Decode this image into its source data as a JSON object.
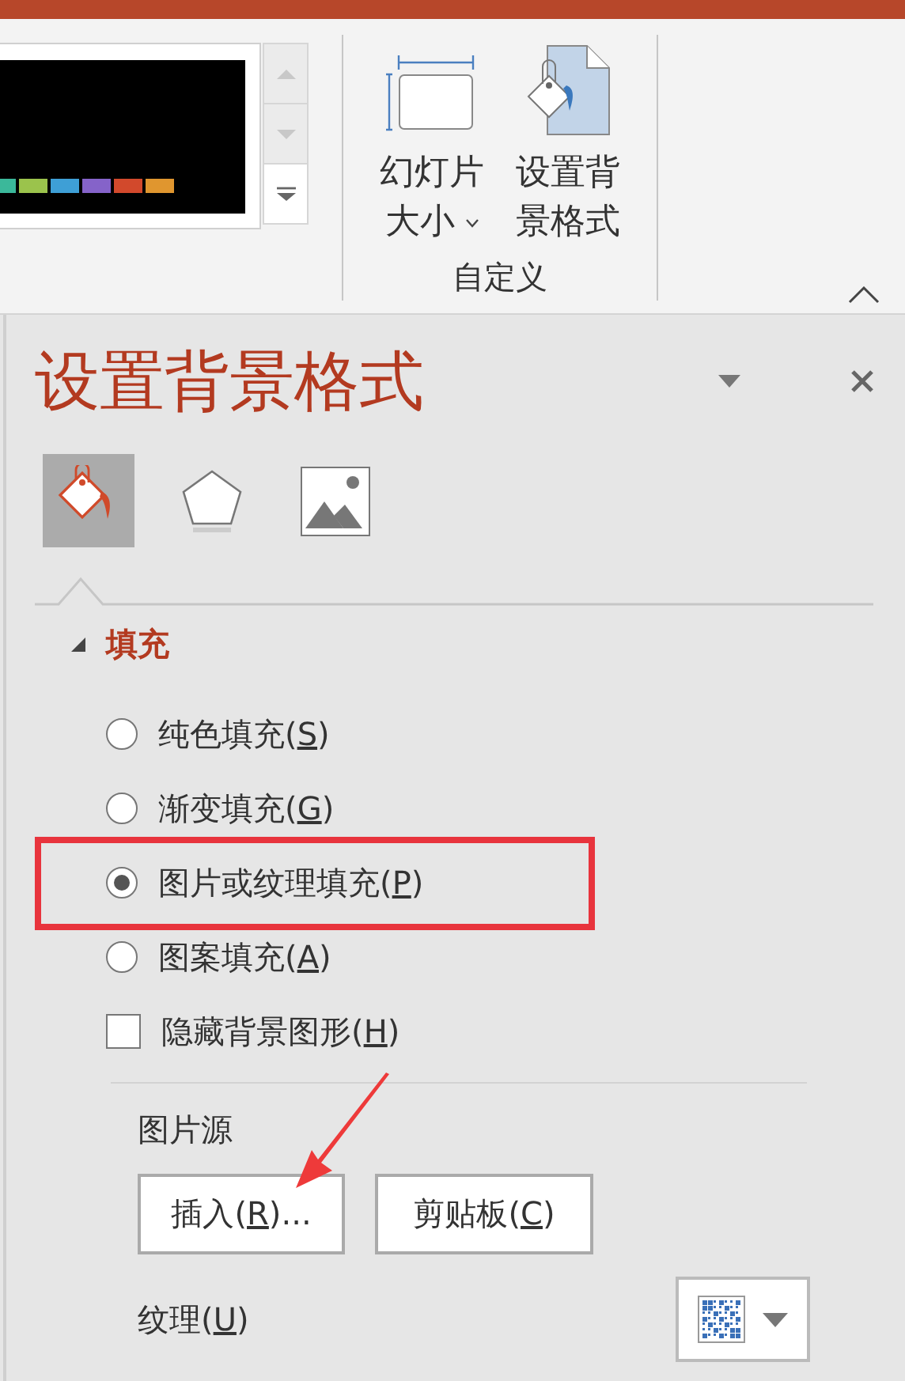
{
  "ribbon": {
    "theme_swatches": [
      {
        "color": "#3bb89a"
      },
      {
        "color": "#9bc34c"
      },
      {
        "color": "#3e9fd6"
      },
      {
        "color": "#8563c9"
      },
      {
        "color": "#d2492c"
      },
      {
        "color": "#e0962f"
      }
    ],
    "buttons": [
      {
        "kind": "slide_size",
        "lines": [
          "幻灯片",
          "大小"
        ],
        "has_menu": true
      },
      {
        "kind": "format_background",
        "lines": [
          "设置背",
          "景格式"
        ],
        "has_menu": false
      }
    ],
    "group_label": "自定义"
  },
  "pane": {
    "title": "设置背景格式",
    "tabs": [
      {
        "kind": "fill",
        "selected": true
      },
      {
        "kind": "effects",
        "selected": false
      },
      {
        "kind": "picture",
        "selected": false
      }
    ],
    "section": {
      "title": "填充",
      "expanded": true
    },
    "options": [
      {
        "kind": "radio",
        "label": "纯色填充(S)",
        "selected": false
      },
      {
        "kind": "radio",
        "label": "渐变填充(G)",
        "selected": false
      },
      {
        "kind": "radio",
        "label": "图片或纹理填充(P)",
        "selected": true
      },
      {
        "kind": "radio",
        "label": "图案填充(A)",
        "selected": false
      },
      {
        "kind": "checkbox",
        "label": "隐藏背景图形(H)",
        "checked": false
      }
    ],
    "picture_source": {
      "label": "图片源",
      "buttons": [
        "插入(R)...",
        "剪贴板(C)"
      ]
    },
    "texture": {
      "label": "纹理(U)"
    }
  },
  "annotations": {
    "highlight_box": true,
    "arrow": true
  }
}
